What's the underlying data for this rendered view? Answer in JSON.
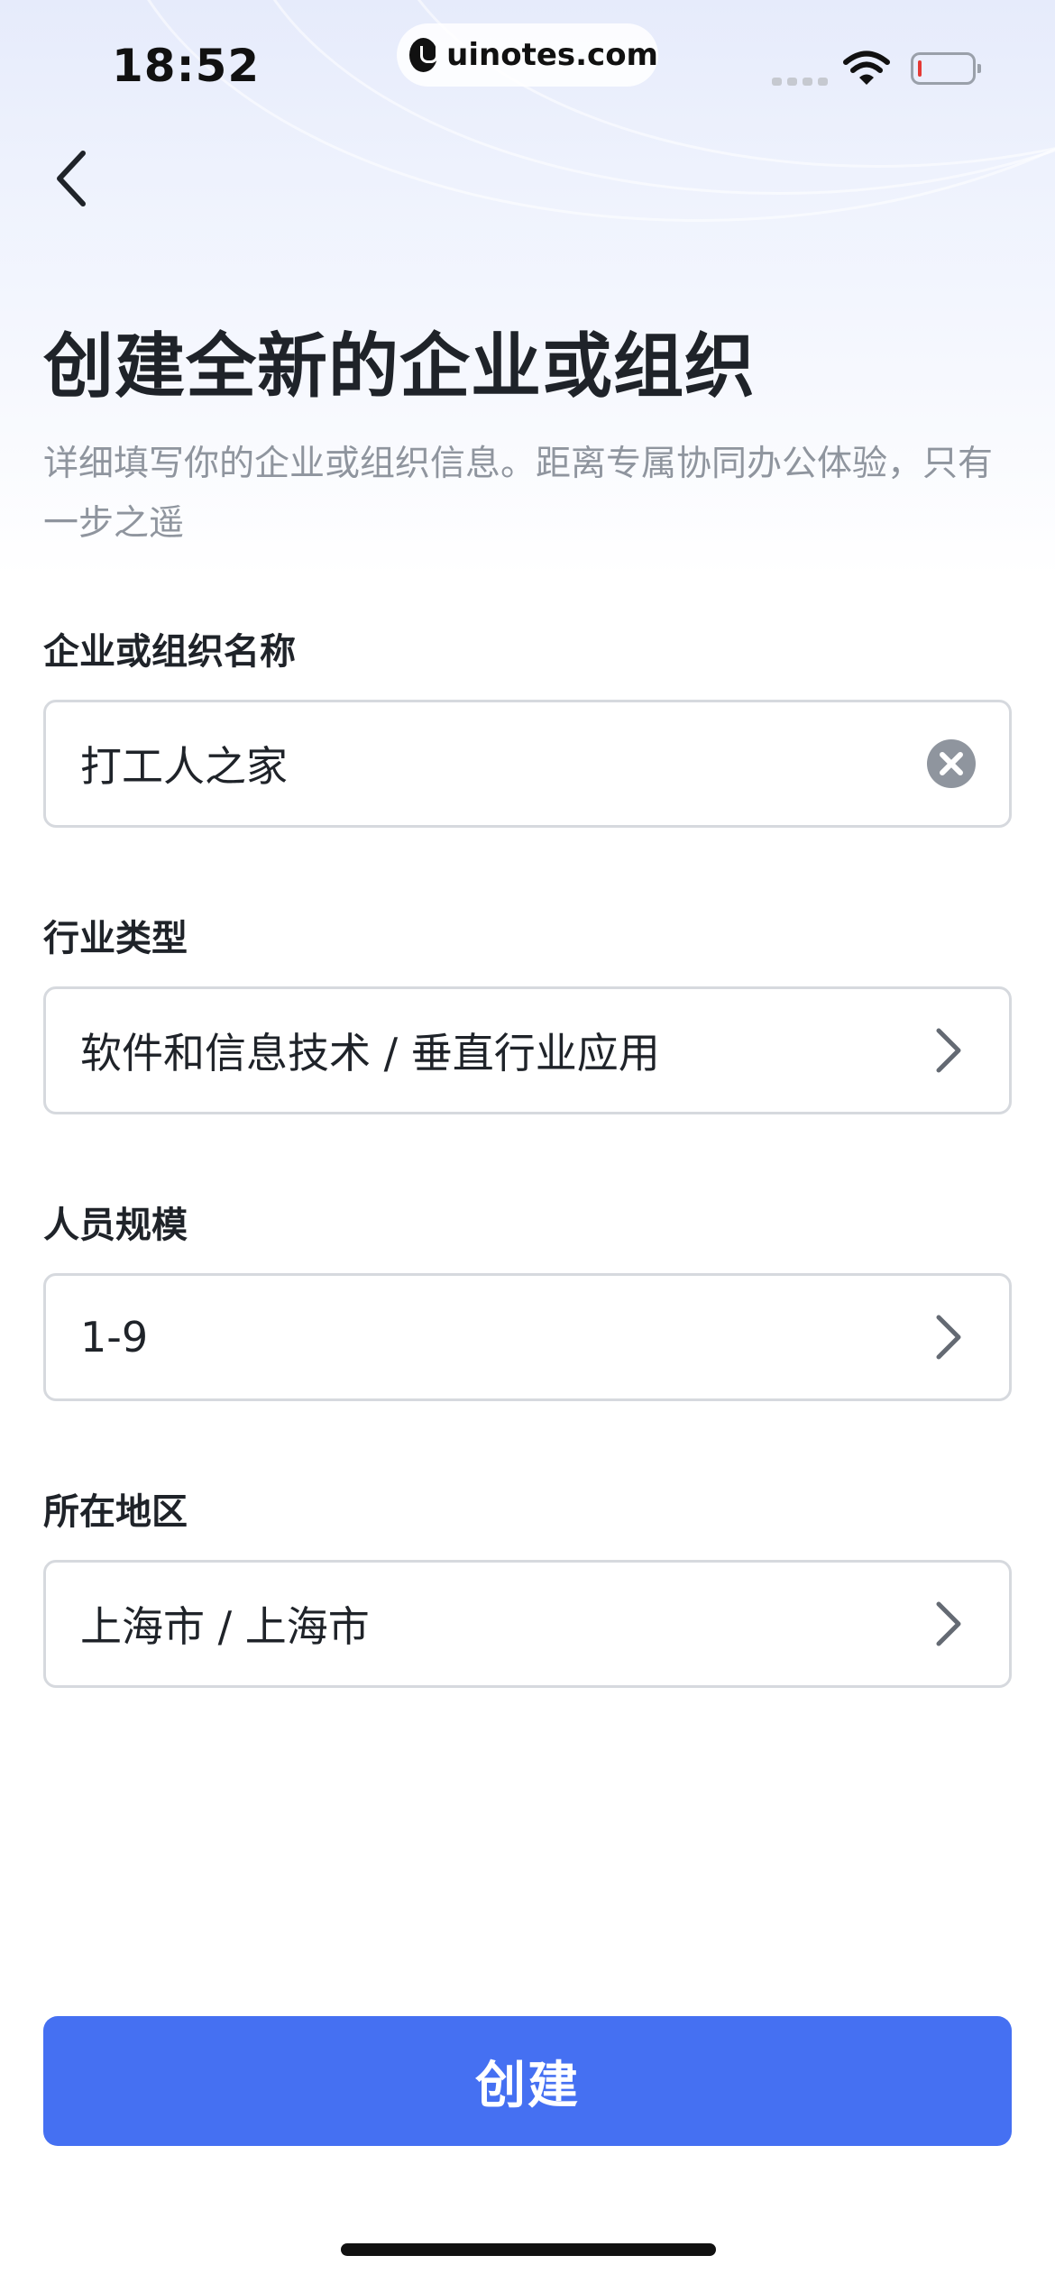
{
  "status_bar": {
    "time": "18:52",
    "watermark": "uinotes.com"
  },
  "header": {
    "title": "创建全新的企业或组织",
    "description": "详细填写你的企业或组织信息。距离专属协同办公体验，只有一步之遥"
  },
  "form": {
    "org_name": {
      "label": "企业或组织名称",
      "value": "打工人之家"
    },
    "industry": {
      "label": "行业类型",
      "value": "软件和信息技术 / 垂直行业应用"
    },
    "staff_size": {
      "label": "人员规模",
      "value": "1-9"
    },
    "region": {
      "label": "所在地区",
      "value": "上海市 / 上海市"
    }
  },
  "actions": {
    "create_label": "创建"
  },
  "colors": {
    "accent": "#4570f2",
    "battery_low": "#e53935"
  }
}
